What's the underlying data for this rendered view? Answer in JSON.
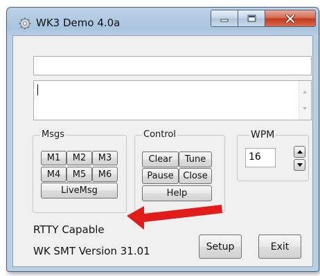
{
  "window": {
    "title": "WK3 Demo 4.0a"
  },
  "icons": {
    "app": "gear-icon",
    "minimize": "minimize-icon",
    "maximize": "maximize-icon",
    "close": "close-icon",
    "annotation": "red-arrow"
  },
  "colors": {
    "annotation_arrow": "#e21b1b"
  },
  "groups": {
    "msgs": "Msgs",
    "control": "Control",
    "wpm": "WPM"
  },
  "msgs_buttons": [
    "M1",
    "M2",
    "M3",
    "M4",
    "M5",
    "M6"
  ],
  "live_msg_label": "LiveMsg",
  "control_buttons": {
    "clear": "Clear",
    "tune": "Tune",
    "pause": "Pause",
    "close": "Close",
    "help": "Help"
  },
  "wpm_value": "16",
  "status": {
    "rtty": "RTTY Capable",
    "version": "WK SMT Version 31.01"
  },
  "actions": {
    "setup": "Setup",
    "exit": "Exit"
  }
}
